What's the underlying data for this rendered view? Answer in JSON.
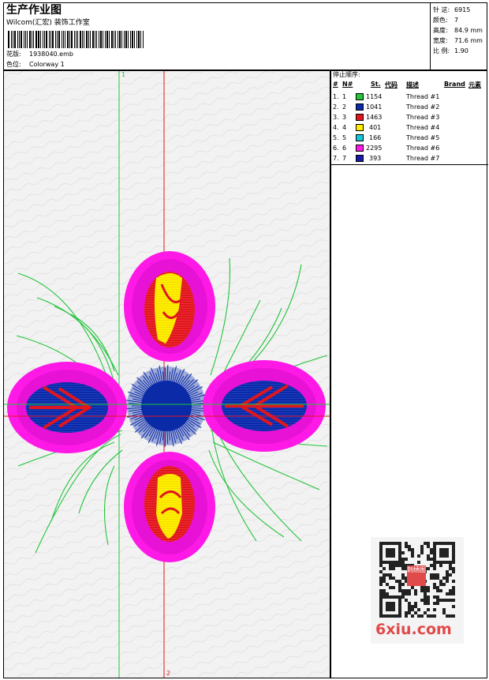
{
  "header": {
    "title": "生产作业图",
    "company": "Wilcom(汇宏) 装饰工作室",
    "design_label": "花版:",
    "design_file": "1938040.emb",
    "colorway_label": "色位:",
    "colorway": "Colorway 1"
  },
  "stats": [
    {
      "label": "针 这:",
      "value": "6915"
    },
    {
      "label": "颜色:",
      "value": "7"
    },
    {
      "label": "高度:",
      "value": "84.9 mm"
    },
    {
      "label": "宽度:",
      "value": "71.6 mm"
    },
    {
      "label": "比 例:",
      "value": "1.90"
    }
  ],
  "stop_sequence": {
    "title": "停止顺序:",
    "columns": [
      "#",
      "N#",
      "St.",
      "代码",
      "描述",
      "Brand",
      "元素"
    ],
    "rows": [
      {
        "seq": "1.",
        "n": "1",
        "color": "#22c43a",
        "stitches": "1154",
        "description": "Thread #1"
      },
      {
        "seq": "2.",
        "n": "2",
        "color": "#0a2aa8",
        "stitches": "1041",
        "description": "Thread #2"
      },
      {
        "seq": "3.",
        "n": "3",
        "color": "#e0161e",
        "stitches": "1463",
        "description": "Thread #3"
      },
      {
        "seq": "4.",
        "n": "4",
        "color": "#ffee00",
        "stitches": "401",
        "description": "Thread #4"
      },
      {
        "seq": "5.",
        "n": "5",
        "color": "#19c6d8",
        "stitches": "166",
        "description": "Thread #5"
      },
      {
        "seq": "6.",
        "n": "6",
        "color": "#ff19e6",
        "stitches": "2295",
        "description": "Thread #6"
      },
      {
        "seq": "7.",
        "n": "7",
        "color": "#1a1aa6",
        "stitches": "393",
        "description": "Thread #7"
      }
    ]
  },
  "guides": {
    "vertical_label": "1",
    "horizontal_label": "2"
  },
  "watermark": {
    "text": "6xiu.com",
    "seal_text": "刺绣图"
  },
  "colors": {
    "guide_green": "#22c43a",
    "guide_red": "#e0161e",
    "magenta": "#ff19e6",
    "blue": "#0a2aa8",
    "yellow": "#ffee00",
    "watermark_red": "#e04a4a"
  }
}
